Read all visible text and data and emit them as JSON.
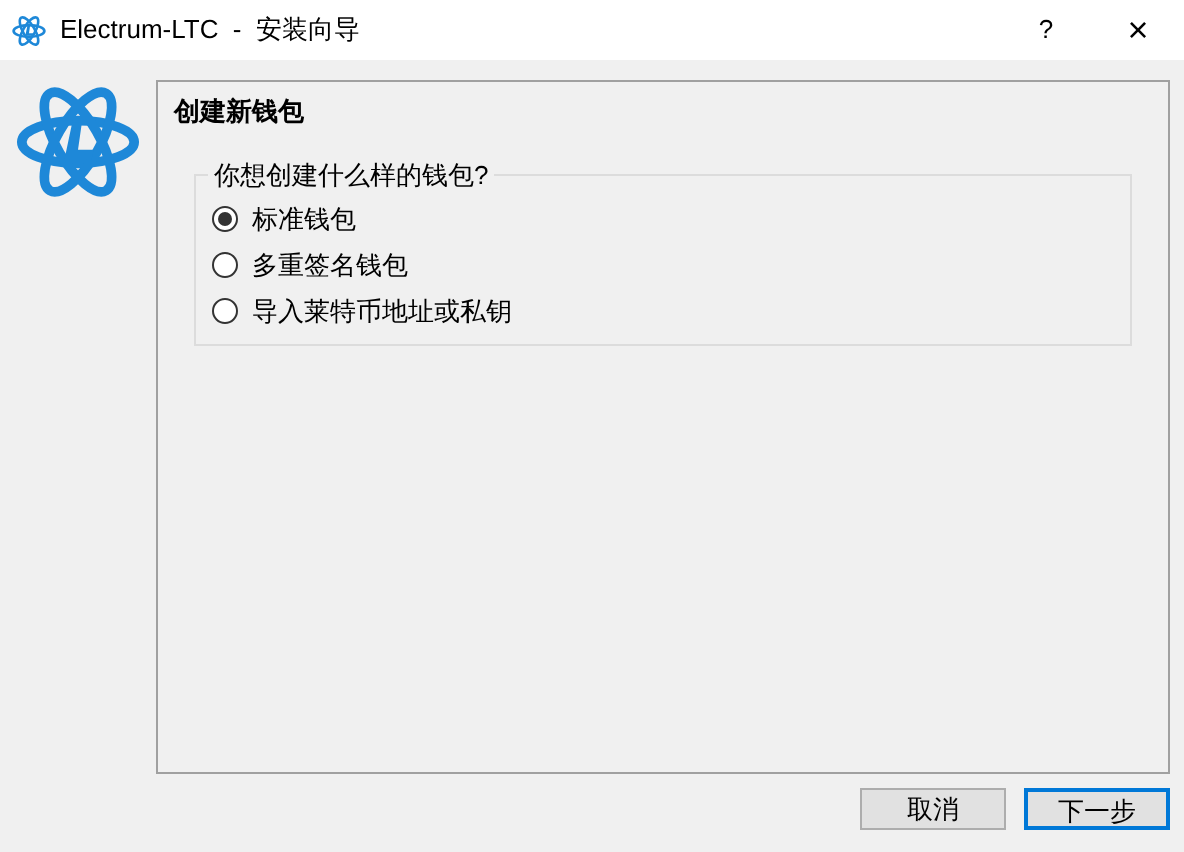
{
  "window": {
    "title": "Electrum-LTC  -  安装向导",
    "help": "?",
    "close": "×"
  },
  "page": {
    "heading": "创建新钱包",
    "group_title": "你想创建什么样的钱包?",
    "options": [
      {
        "label": "标准钱包",
        "selected": true
      },
      {
        "label": "多重签名钱包",
        "selected": false
      },
      {
        "label": "导入莱特币地址或私钥",
        "selected": false
      }
    ]
  },
  "buttons": [
    {
      "label": "取消",
      "default": false
    },
    {
      "label": "下一步",
      "default": true
    }
  ]
}
